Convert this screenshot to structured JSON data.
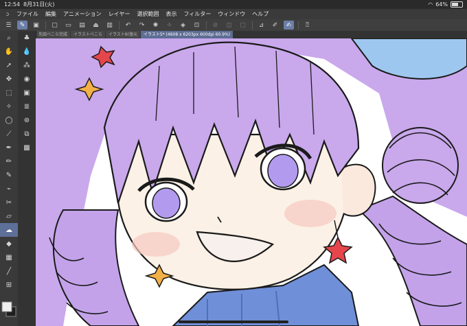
{
  "status": {
    "time": "12:54",
    "date": "8月31日(火)",
    "battery": "64%",
    "battery_level": 0.64
  },
  "menu": {
    "items": [
      "ファイル",
      "編集",
      "アニメーション",
      "レイヤー",
      "選択範囲",
      "表示",
      "フィルター",
      "ウィンドウ",
      "ヘルプ"
    ]
  },
  "tabs": [
    {
      "label": "先田べこら完成"
    },
    {
      "label": "イラストべこら"
    },
    {
      "label": "イラスト8(復元"
    },
    {
      "label": "イラスト5* (4608 x 6203px 600dpi 60.9%)"
    }
  ],
  "colors": {
    "accent": "#5e6f98",
    "hair": "#c9a8ec",
    "skin": "#fbf1e6",
    "outline": "#1a1a1a",
    "eye": "#b29bef",
    "outfit": "#6f8fd8",
    "star_red": "#e4464c",
    "star_orange": "#f2b046"
  }
}
